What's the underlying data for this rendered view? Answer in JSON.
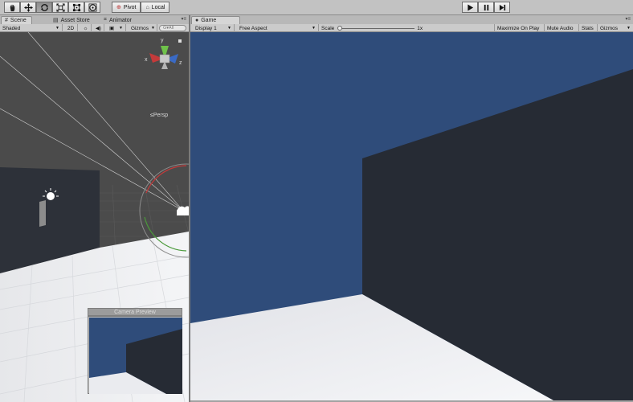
{
  "toolbar": {
    "tools": [
      "hand-tool",
      "move-tool",
      "rotate-tool",
      "scale-tool",
      "rect-tool",
      "transform-tool"
    ],
    "pivot_label": "Pivot",
    "local_label": "Local",
    "play_controls": [
      "play",
      "pause",
      "step"
    ]
  },
  "scene_panel": {
    "tabs": [
      {
        "label": "Scene",
        "icon": "scene-icon",
        "active": true
      },
      {
        "label": "Asset Store",
        "icon": "store-icon",
        "active": false
      },
      {
        "label": "Animator",
        "icon": "animator-icon",
        "active": false
      }
    ],
    "shading_mode": "Shaded",
    "mode_2d_label": "2D",
    "gizmos_label": "Gizmos",
    "search_placeholder": "G▾All",
    "projection_label": "Persp",
    "camera_preview_title": "Camera Preview"
  },
  "game_panel": {
    "tab_label": "Game",
    "tab_icon": "game-controller-icon",
    "display_label": "Display 1",
    "aspect_label": "Free Aspect",
    "scale_label": "Scale",
    "scale_value": "1x",
    "scale_fraction": 0.0,
    "maximize_label": "Maximize On Play",
    "mute_label": "Mute Audio",
    "stats_label": "Stats",
    "gizmos_label": "Gizmos"
  },
  "colors": {
    "sky_blue": "#2f4c7a",
    "wall_dark": "#262b34",
    "floor_white": "#eaebef",
    "scene_bg": "#4a4a4a",
    "editor_gray": "#c2c2c2"
  }
}
